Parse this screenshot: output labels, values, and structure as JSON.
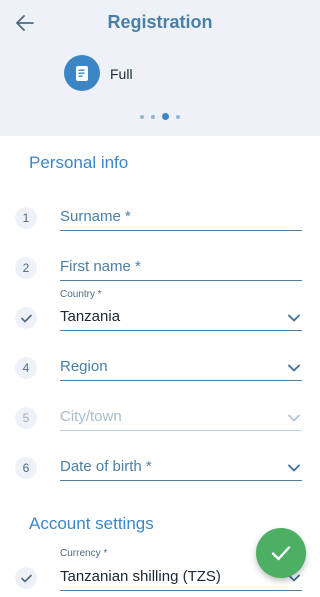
{
  "header": {
    "title": "Registration",
    "registration_type": "Full",
    "step_dots": 4,
    "active_step_dot": 3
  },
  "personal_info": {
    "section_title": "Personal info",
    "fields": [
      {
        "step": "1",
        "label": "Surname *"
      },
      {
        "step": "2",
        "label": "First name *"
      },
      {
        "small_label": "Country *",
        "value": "Tanzania"
      },
      {
        "step": "4",
        "label": "Region"
      },
      {
        "step": "5",
        "label": "City/town"
      },
      {
        "step": "6",
        "label": "Date of birth *"
      }
    ]
  },
  "account_settings": {
    "section_title": "Account settings",
    "currency_label": "Currency *",
    "currency_value": "Tanzanian shilling (TZS)"
  },
  "colors": {
    "accent": "#3d86c6",
    "confirm": "#4caf63",
    "header_bg": "#eef2f8"
  },
  "icons": {
    "back": "arrow-left-icon",
    "type": "document-icon",
    "check": "check-icon",
    "dropdown": "chevron-down-icon",
    "confirm": "check-icon"
  }
}
